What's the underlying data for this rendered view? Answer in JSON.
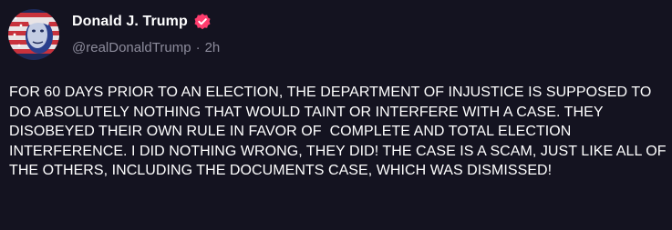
{
  "author": {
    "display_name": "Donald J. Trump",
    "handle": "@realDonaldTrump",
    "separator": "·",
    "timestamp": "2h",
    "verified": true,
    "verified_badge_color": "#ff3d6e"
  },
  "post": {
    "text": "FOR 60 DAYS PRIOR TO AN ELECTION, THE DEPARTMENT OF INJUSTICE IS SUPPOSED TO DO ABSOLUTELY NOTHING THAT WOULD TAINT OR INTERFERE WITH A CASE. THEY DISOBEYED THEIR OWN RULE IN FAVOR OF  COMPLETE AND TOTAL ELECTION INTERFERENCE. I DID NOTHING WRONG, THEY DID! THE CASE IS A SCAM, JUST LIKE ALL OF THE OTHERS, INCLUDING THE DOCUMENTS CASE, WHICH WAS DISMISSED!"
  },
  "icons": {
    "avatar": "profile-avatar",
    "verified": "verified-badge-icon"
  },
  "colors": {
    "background": "#141320",
    "text": "#ffffff",
    "muted": "#8c8b9b",
    "accent": "#ff3d6e"
  }
}
